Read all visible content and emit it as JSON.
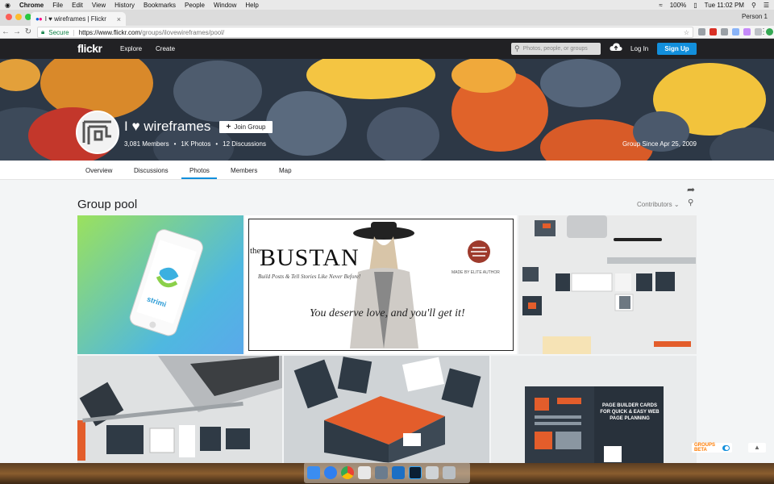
{
  "macos_menubar": {
    "apple": "",
    "menus": [
      "Chrome",
      "File",
      "Edit",
      "View",
      "History",
      "Bookmarks",
      "People",
      "Window",
      "Help"
    ],
    "battery": "100%",
    "clock": "Tue 11:02 PM"
  },
  "browser": {
    "tab_title": "I ♥ wireframes | Flickr",
    "tab_close": "×",
    "profile": "Person 1",
    "secure_label": "Secure",
    "url_host": "https://www.flickr.com",
    "url_path": "/groups/ilovewireframes/pool/"
  },
  "flickr_nav": {
    "logo": "flickr",
    "explore": "Explore",
    "create": "Create",
    "search_placeholder": "Photos, people, or groups",
    "login": "Log In",
    "signup": "Sign Up"
  },
  "group": {
    "title": "I ♥ wireframes",
    "join_label": "Join Group",
    "members": "3,081 Members",
    "photos": "1K Photos",
    "discussions": "12 Discussions",
    "since": "Group Since Apr 25, 2009"
  },
  "subnav": {
    "tabs": [
      "Overview",
      "Discussions",
      "Photos",
      "Members",
      "Map"
    ],
    "active": "Photos"
  },
  "pool": {
    "title": "Group pool",
    "contributors_label": "Contributors",
    "photos": [
      {
        "caption": "strimi"
      },
      {
        "caption": "BUSTAN",
        "prefix": "the",
        "tagline": "Build Posts & Tell Stories Like Never Before!",
        "quote": "You deserve love, and you'll get it!",
        "author_tag": "MADE BY ELITE AUTHOR"
      },
      {
        "caption": ""
      },
      {
        "caption": ""
      },
      {
        "caption": ""
      },
      {
        "caption": "PAGE BUILDER CARDS FOR QUICK & EASY WEB PAGE PLANNING"
      }
    ]
  },
  "widgets": {
    "groups_beta": "GROUPS BETA"
  },
  "colors": {
    "flickr_dark": "#212124",
    "flickr_blue": "#128fdc",
    "beta_orange": "#ff7b00"
  }
}
